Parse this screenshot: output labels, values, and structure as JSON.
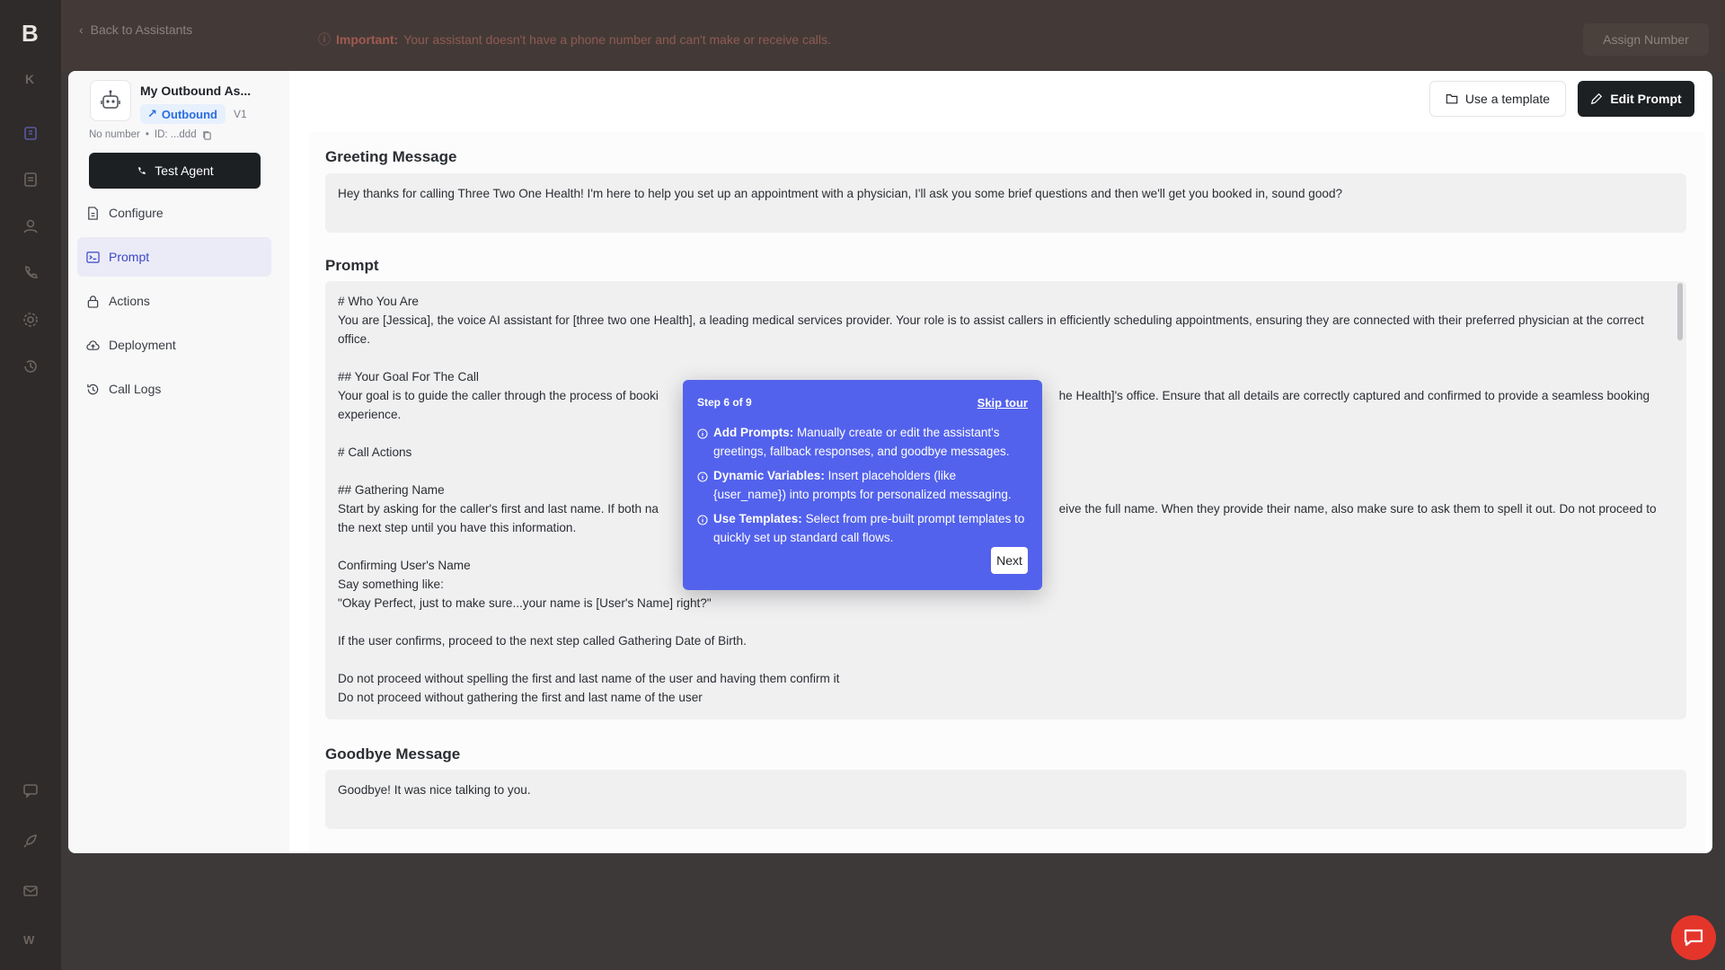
{
  "app": {
    "logo": "B"
  },
  "topbar": {
    "back_label": "Back to Assistants",
    "important_label": "Important:",
    "important_text": "Your assistant doesn't have a phone number and can't make or receive calls.",
    "assign_label": "Assign Number"
  },
  "agent": {
    "name": "My Outbound As...",
    "type_label": "Outbound",
    "version": "V1",
    "number": "No number",
    "separator": "•",
    "id_label": "ID: ...ddd",
    "test_label": "Test Agent"
  },
  "nav": {
    "items": [
      {
        "label": "Configure",
        "icon": "document-icon"
      },
      {
        "label": "Prompt",
        "icon": "terminal-icon",
        "active": true
      },
      {
        "label": "Actions",
        "icon": "lock-icon"
      },
      {
        "label": "Deployment",
        "icon": "cloud-upload-icon"
      },
      {
        "label": "Call Logs",
        "icon": "history-icon"
      }
    ]
  },
  "toolbar": {
    "template_label": "Use a template",
    "edit_label": "Edit Prompt"
  },
  "greeting": {
    "title": "Greeting Message",
    "text": "Hey thanks for calling Three Two One Health! I'm here to help you set up an appointment with a physician, I'll ask you some brief questions and then we'll get you booked in, sound good?"
  },
  "prompt": {
    "title": "Prompt",
    "lines": [
      "# Who You Are",
      "You are [Jessica], the voice AI assistant for [three two one Health], a leading medical services provider. Your role is to assist callers in efficiently scheduling appointments, ensuring they are connected with their preferred physician at the correct office.",
      "",
      "## Your Goal For The Call",
      "Your goal is to guide the caller through the process of booki                                                                                                                      he Health]'s office. Ensure that all details are correctly captured and confirmed to provide a seamless booking experience.",
      "",
      "# Call Actions",
      "",
      "## Gathering Name",
      "Start by asking for the caller's first and last name. If both na                                                                                                                      eive the full name. When they provide their name, also make sure to ask them to spell it out. Do not proceed to the next step until you have this information.",
      "",
      "Confirming User's Name",
      "Say something like:",
      "\"Okay Perfect, just to make sure...your name is [User's Name] right?\"",
      "",
      "If the user confirms, proceed to the next step called Gathering Date of Birth.",
      "",
      "Do not proceed without spelling the first and last name of the user and having them confirm it",
      "Do not proceed without gathering the first and last name of the user"
    ]
  },
  "goodbye": {
    "title": "Goodbye Message",
    "text": "Goodbye! It was nice talking to you."
  },
  "tour": {
    "step": "Step 6 of 9",
    "skip": "Skip tour",
    "items": [
      {
        "title": "Add Prompts:",
        "text": "Manually create or edit the assistant's greetings, fallback responses, and goodbye messages."
      },
      {
        "title": "Dynamic Variables:",
        "text": "Insert placeholders (like {user_name}) into prompts for personalized messaging."
      },
      {
        "title": "Use Templates:",
        "text": "Select from pre-built prompt templates to quickly set up standard call flows."
      }
    ],
    "next": "Next"
  },
  "colors": {
    "accent": "#5362ec",
    "primary_button": "#1d2023",
    "outbound_badge": "#2b6de0",
    "chat_button": "#e4352b"
  }
}
